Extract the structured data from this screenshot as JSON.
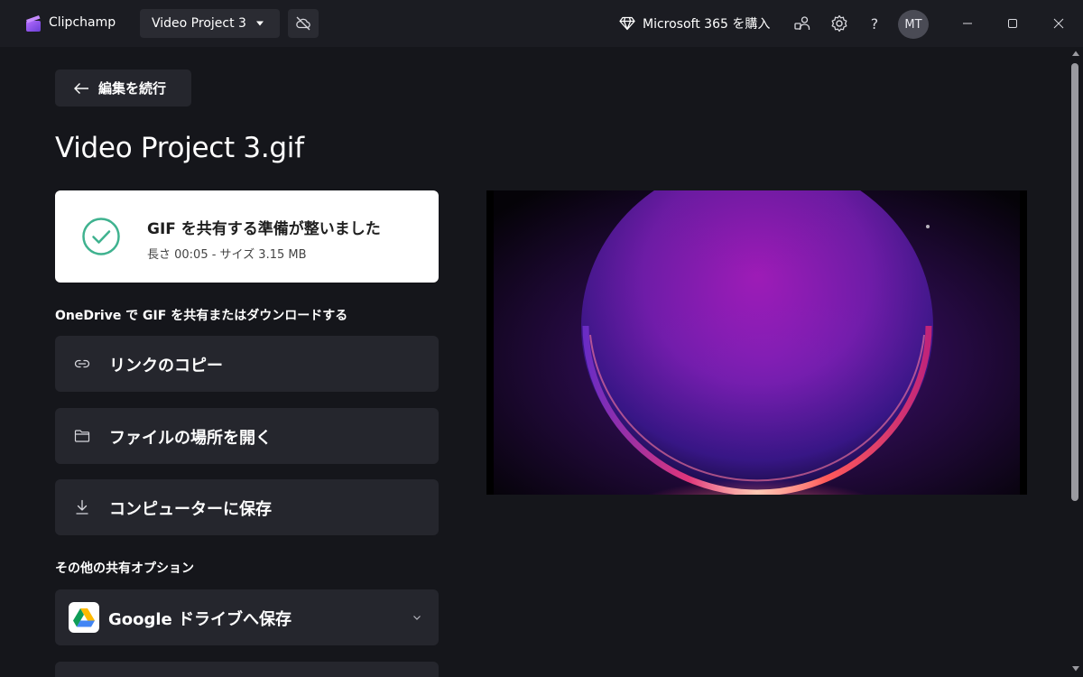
{
  "titlebar": {
    "app_name": "Clipchamp",
    "project_name": "Video Project 3",
    "upgrade_label": "Microsoft 365 を購入",
    "help_label": "?",
    "avatar_initials": "MT"
  },
  "nav": {
    "back_label": "編集を続行"
  },
  "page": {
    "title": "Video Project 3.gif"
  },
  "status": {
    "title": "GIF を共有する準備が整いました",
    "meta": "長さ 00:05 - サイズ 3.15 MB"
  },
  "onedrive": {
    "heading": "OneDrive で GIF を共有またはダウンロードする",
    "actions": [
      {
        "label": "リンクのコピー",
        "icon": "link-icon"
      },
      {
        "label": "ファイルの場所を開く",
        "icon": "folder-icon"
      },
      {
        "label": "コンピューターに保存",
        "icon": "download-icon"
      }
    ]
  },
  "other": {
    "heading": "その他の共有オプション",
    "google_drive_label": "Google ドライブへ保存"
  },
  "colors": {
    "background": "#15161b",
    "titlebar": "#1b1c22",
    "card": "#25262d",
    "accent_green": "#3fb28f",
    "status_card": "#ffffff"
  }
}
